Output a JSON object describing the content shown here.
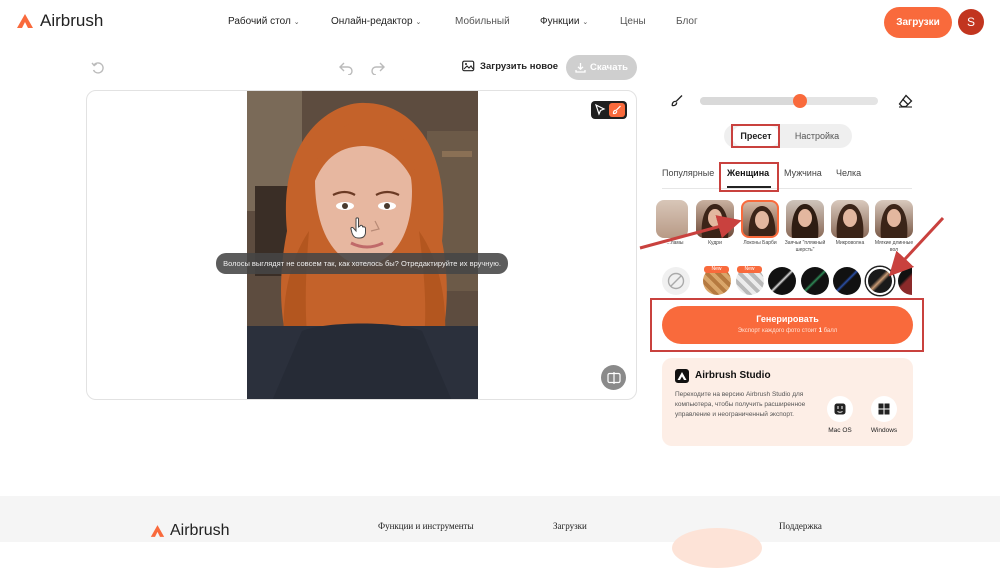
{
  "header": {
    "logo_text": "Airbrush",
    "nav": [
      {
        "label": "Рабочий стол",
        "has_dropdown": true
      },
      {
        "label": "Онлайн-редактор",
        "has_dropdown": true
      },
      {
        "label": "Мобильный",
        "has_dropdown": false
      },
      {
        "label": "Функции",
        "has_dropdown": true
      },
      {
        "label": "Цены",
        "has_dropdown": false
      },
      {
        "label": "Блог",
        "has_dropdown": false
      }
    ],
    "download_button": "Загрузки",
    "avatar_letter": "S"
  },
  "toolbar": {
    "upload_new": "Загрузить новое",
    "download": "Скачать"
  },
  "canvas": {
    "tooltip": "Волосы выглядят не совсем так, как хотелось бы? Отредактируйте их вручную."
  },
  "brush": {
    "level": 0.56
  },
  "segment": {
    "preset": "Пресет",
    "settings": "Настройка",
    "active": "Пресет"
  },
  "tabs": [
    {
      "label": "Популярные",
      "active": false
    },
    {
      "label": "Женщина",
      "active": true
    },
    {
      "label": "Мужчина",
      "active": false
    },
    {
      "label": "Челка",
      "active": false
    }
  ],
  "styles": [
    {
      "label": "...ламы",
      "selected": false
    },
    {
      "label": "Кудри",
      "selected": false
    },
    {
      "label": "Локоны Барби",
      "selected": true
    },
    {
      "label": "Заячьи \"пляжный шерсть\"",
      "selected": false
    },
    {
      "label": "Микроволна",
      "selected": false
    },
    {
      "label": "Мягкие длинные вол",
      "selected": false
    }
  ],
  "colors": [
    {
      "name": "none",
      "badge": ""
    },
    {
      "name": "honey",
      "badge": "New"
    },
    {
      "name": "silver",
      "badge": "New"
    },
    {
      "name": "black-white",
      "badge": ""
    },
    {
      "name": "black-green",
      "badge": ""
    },
    {
      "name": "black-blue",
      "badge": ""
    },
    {
      "name": "brown-selected",
      "badge": "",
      "selected": true
    },
    {
      "name": "black-red",
      "badge": ""
    }
  ],
  "generate": {
    "label": "Генерировать",
    "sub_prefix": "Экспорт каждого фото стоит",
    "sub_count": "1",
    "sub_suffix": "балл"
  },
  "studio": {
    "title": "Airbrush Studio",
    "text": "Переходите на версию Airbrush Studio для компьютера, чтобы получить расширенное управление и неограниченный экспорт.",
    "mac": "Mac OS",
    "windows": "Windows"
  },
  "footer": {
    "logo_text": "Airbrush",
    "col1": "Функции и инструменты",
    "col2": "Загрузки",
    "col3": "Поддержка"
  },
  "colors_theme": {
    "accent": "#f96a3c",
    "annotation": "#c9413e"
  }
}
